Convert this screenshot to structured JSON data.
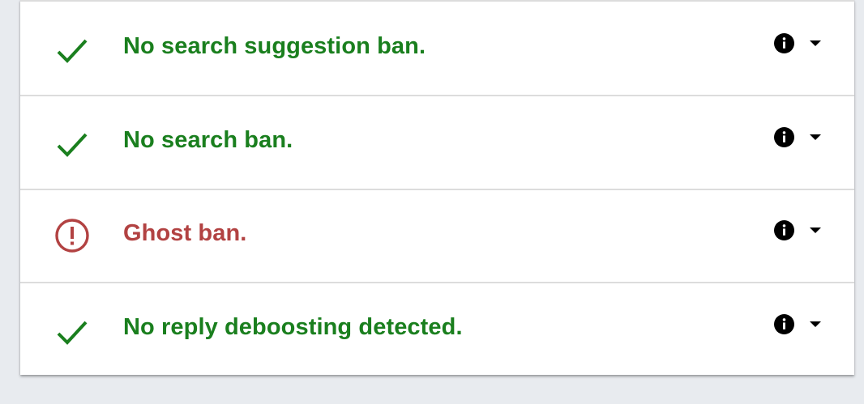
{
  "colors": {
    "ok": "#1a7f1e",
    "ban": "#b24242",
    "background": "#e8ebef",
    "card": "#ffffff"
  },
  "results": [
    {
      "label": "No search suggestion ban.",
      "status": "ok",
      "icon": "check-icon"
    },
    {
      "label": "No search ban.",
      "status": "ok",
      "icon": "check-icon"
    },
    {
      "label": "Ghost ban.",
      "status": "ban",
      "icon": "alert-circle-icon"
    },
    {
      "label": "No reply deboosting detected.",
      "status": "ok",
      "icon": "check-icon"
    }
  ]
}
